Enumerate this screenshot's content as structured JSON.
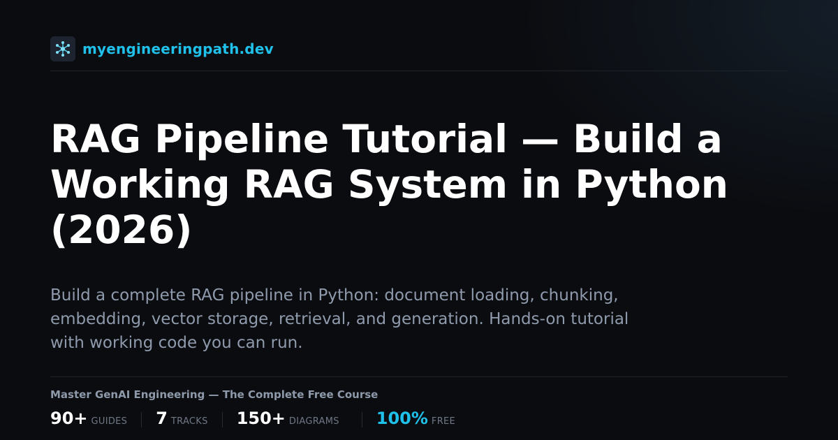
{
  "header": {
    "logo_icon": "network-nodes-icon",
    "site_name": "myengineeringpath.dev"
  },
  "article": {
    "title": "RAG Pipeline Tutorial — Build a Working RAG System in Python (2026)",
    "description": "Build a complete RAG pipeline in Python: document loading, chunking, embedding, vector storage, retrieval, and generation. Hands-on tutorial with working code you can run."
  },
  "footer": {
    "course_title": "Master GenAI Engineering — The Complete Free Course",
    "stats": [
      {
        "value": "90+",
        "label": "GUIDES"
      },
      {
        "value": "7",
        "label": "TRACKS"
      },
      {
        "value": "150+",
        "label": "DIAGRAMS"
      },
      {
        "value": "100%",
        "label": "FREE"
      }
    ]
  },
  "colors": {
    "background": "#0b0c10",
    "accent": "#1fc1ea",
    "title": "#ffffff",
    "body_text": "#8f9bac",
    "muted": "#6f7886"
  }
}
